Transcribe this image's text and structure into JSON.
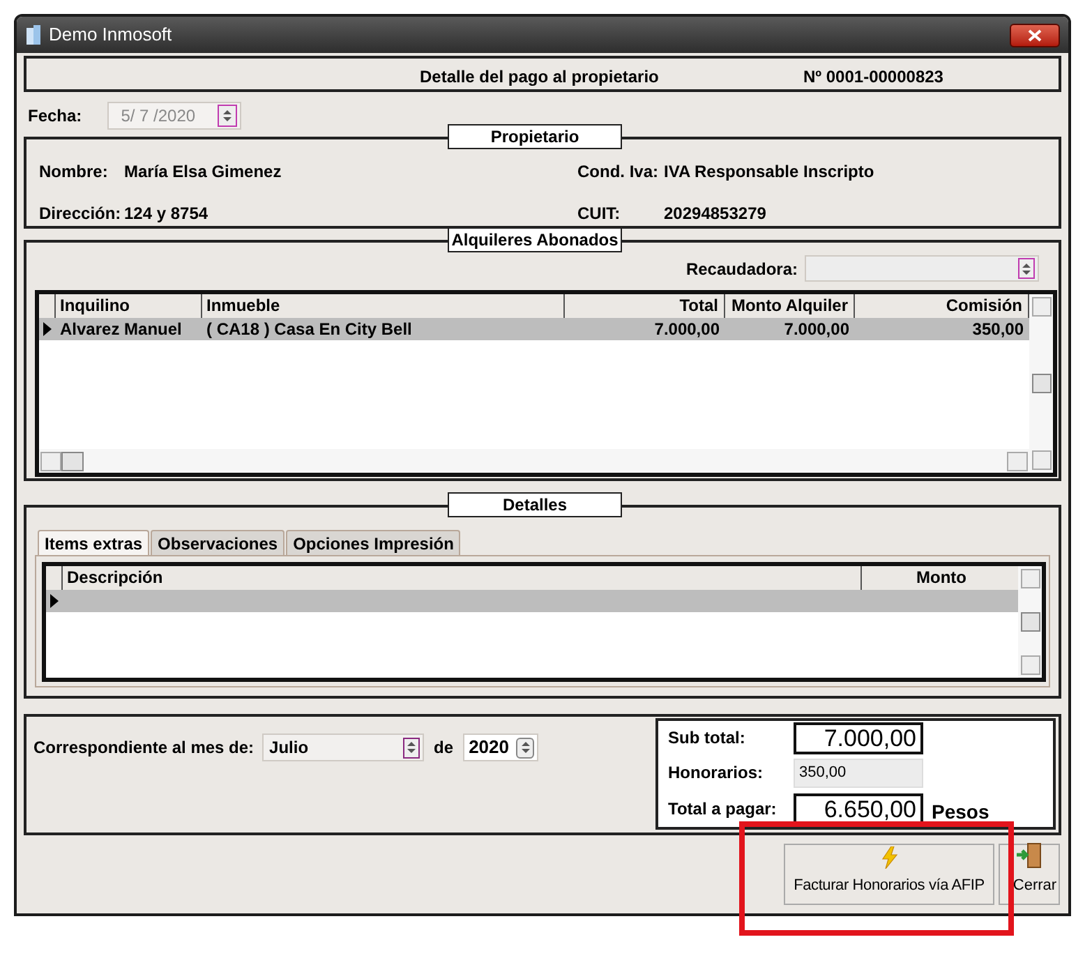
{
  "window": {
    "title": "Demo Inmosoft"
  },
  "header": {
    "title": "Detalle del pago al propietario",
    "number": "Nº 0001-00000823"
  },
  "fecha": {
    "label": "Fecha:",
    "value": "5/ 7 /2020",
    "disabled": true
  },
  "propietario": {
    "legend": "Propietario",
    "fields": [
      {
        "label": "Nombre:",
        "value": "María Elsa Gimenez"
      },
      {
        "label": "Cond. Iva:",
        "value": "IVA Responsable Inscripto"
      },
      {
        "label": "Dirección:",
        "value": "124 y 8754"
      },
      {
        "label": "CUIT:",
        "value": "20294853279"
      }
    ]
  },
  "alquileres": {
    "legend": "Alquileres Abonados",
    "recaudadora": {
      "label": "Recaudadora:"
    },
    "table": {
      "columns": [
        {
          "label": "Inquilino"
        },
        {
          "label": "Inmueble"
        },
        {
          "label": "Total"
        },
        {
          "label": "Monto Alquiler"
        },
        {
          "label": "Comisión"
        }
      ],
      "rows": [
        {
          "selected": true,
          "cells": [
            "Alvarez Manuel",
            "( CA18  ) Casa En City Bell",
            "7.000,00",
            "7.000,00",
            "350,00"
          ]
        }
      ]
    }
  },
  "detalles": {
    "legend": "Detalles",
    "tabs": [
      {
        "label": "Items extras",
        "selected": true
      },
      {
        "label": "Observaciones",
        "selected": false
      },
      {
        "label": "Opciones Impresión",
        "selected": false
      }
    ],
    "table": {
      "columns": [
        {
          "label": "Descripción"
        },
        {
          "label": "Monto"
        }
      ],
      "rows": [
        {
          "selected": true,
          "cells": [
            "",
            ""
          ]
        }
      ]
    }
  },
  "periodo": {
    "label": "Correspondiente al mes de:",
    "month": "Julio",
    "de": "de",
    "year": "2020"
  },
  "totals": [
    {
      "label": "Sub total:",
      "value": "7.000,00",
      "kind": "big"
    },
    {
      "label": "Honorarios:",
      "value": "350,00",
      "kind": "readonly"
    },
    {
      "label": "Total a pagar:",
      "value": "6.650,00",
      "kind": "big",
      "unit": "Pesos"
    }
  ],
  "buttons": [
    {
      "label": "Facturar Honorarios vía AFIP",
      "kind": "lightning"
    },
    {
      "label": "Cerrar",
      "kind": "door"
    }
  ]
}
